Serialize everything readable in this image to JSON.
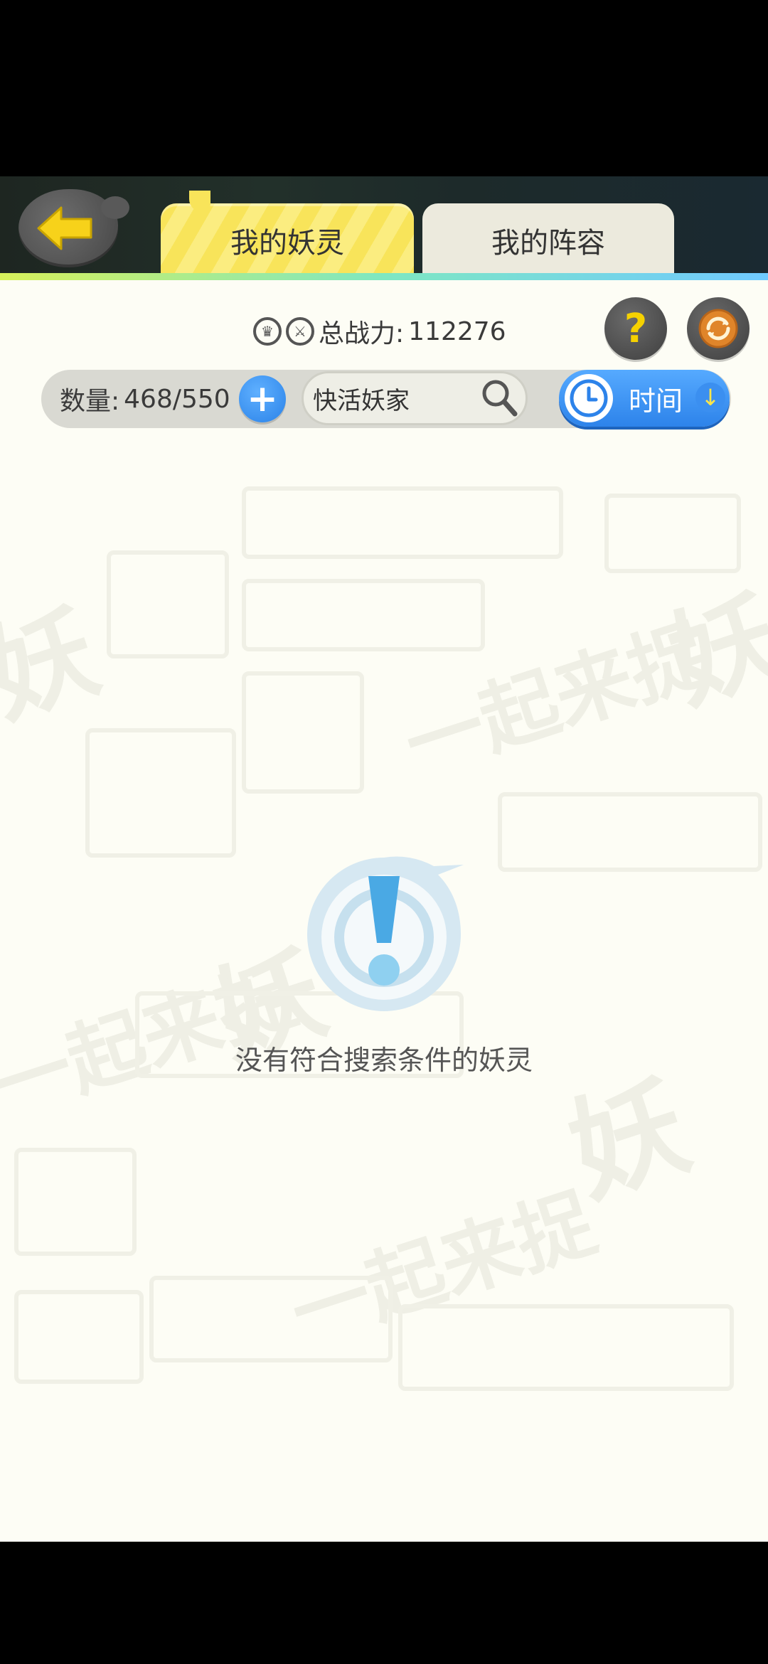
{
  "tabs": [
    {
      "label": "我的妖灵",
      "active": true
    },
    {
      "label": "我的阵容",
      "active": false
    }
  ],
  "stats": {
    "power_label": "总战力:",
    "power_value": "112276"
  },
  "toolbar": {
    "count_label": "数量:",
    "count_value": "468/550",
    "search_value": "快活妖家",
    "sort_label": "时间"
  },
  "empty_state": {
    "message": "没有符合搜索条件的妖灵"
  },
  "colors": {
    "tab_active": "#f8e45a",
    "accent_blue": "#2d83ea",
    "help_yellow": "#f5d100",
    "refresh_orange": "#e0852a"
  },
  "icons": {
    "back": "arrow-left-icon",
    "help": "question-icon",
    "refresh": "refresh-icon",
    "plus": "plus-icon",
    "search": "search-icon",
    "sort": "clock-icon",
    "empty": "exclamation-icon"
  }
}
